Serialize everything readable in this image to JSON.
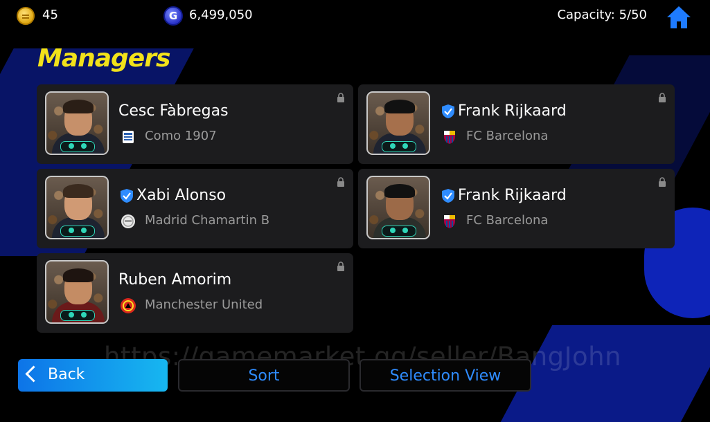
{
  "topbar": {
    "coins": "45",
    "gp": "6,499,050",
    "capacity": "Capacity: 5/50"
  },
  "page_title": "Managers",
  "gp_icon_letter": "G",
  "managers": [
    {
      "name": "Cesc Fàbregas",
      "club": "Como 1907",
      "verified": false,
      "club_logo": "como-crest-icon"
    },
    {
      "name": "Frank Rijkaard",
      "club": "FC Barcelona",
      "verified": true,
      "club_logo": "barcelona-crest-icon"
    },
    {
      "name": "Xabi Alonso",
      "club": "Madrid Chamartin B",
      "verified": true,
      "club_logo": "madrid-chamartin-crest-icon"
    },
    {
      "name": "Frank Rijkaard",
      "club": "FC Barcelona",
      "verified": true,
      "club_logo": "barcelona-crest-icon"
    },
    {
      "name": "Ruben Amorim",
      "club": "Manchester United",
      "verified": false,
      "club_logo": "manchester-united-crest-icon"
    }
  ],
  "watermark": "https://gamemarket.gg/seller/BangJohn",
  "buttons": {
    "back": "Back",
    "sort": "Sort",
    "selection_view": "Selection View"
  },
  "colors": {
    "title": "#f2e21a",
    "accent_blue": "#2f8cff",
    "card_bg": "#1c1c1e",
    "verified": "#2f8cff"
  }
}
